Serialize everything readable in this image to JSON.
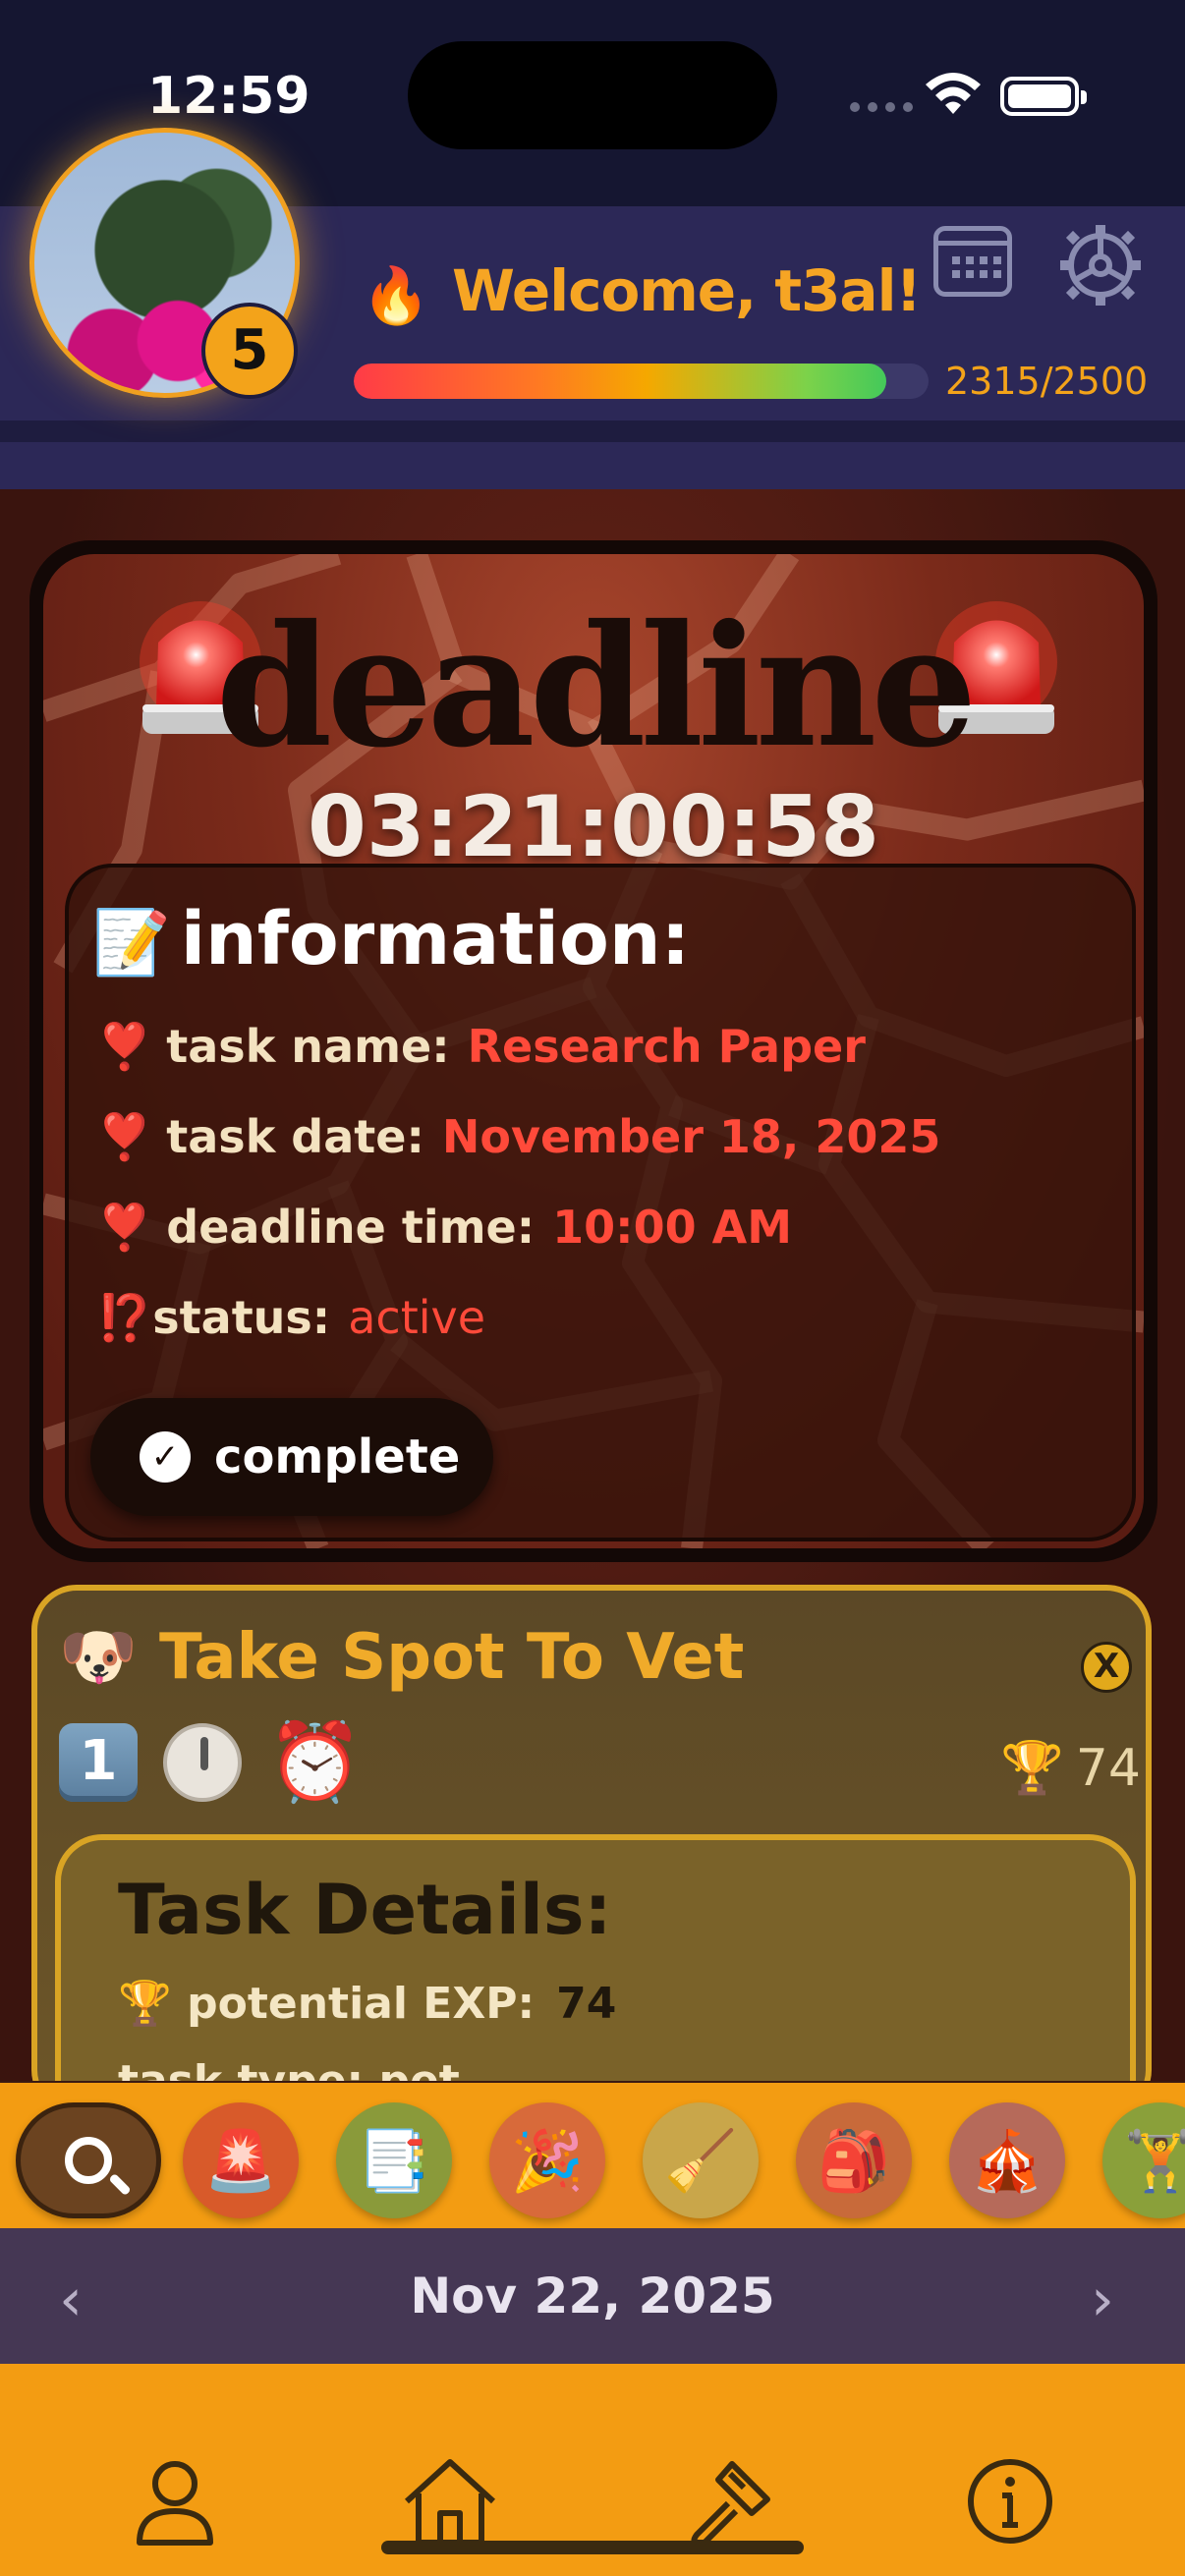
{
  "status_bar": {
    "time": "12:59"
  },
  "header": {
    "level": "5",
    "flame_icon": "🔥",
    "welcome": "Welcome, t3al!",
    "xp_text": "2315/2500",
    "xp_progress": 0.926
  },
  "deadline_card": {
    "title": "deadline",
    "countdown": "03:21:00:58",
    "info": {
      "heading_icon": "📝",
      "heading": "information:",
      "task_name_label": "task name:",
      "task_name": "Research Paper",
      "task_date_label": "task date:",
      "task_date": "November 18, 2025",
      "deadline_time_label": "deadline time:",
      "deadline_time": "10:00 AM",
      "status_label": "status:",
      "status": "active",
      "bullet": "❣️",
      "status_bullet": "⁉️"
    },
    "complete_label": "complete",
    "check_glyph": "✓"
  },
  "task_card": {
    "emoji": "🐶",
    "title": "Take Spot To Vet",
    "close_glyph": "X",
    "priority": "1",
    "alarm_icon": "⏰",
    "trophy_icon": "🏆",
    "score": "74",
    "details": {
      "title": "Task Details:",
      "exp_label": "potential EXP:",
      "exp_value": "74",
      "type_partial": "task type: pet"
    }
  },
  "categories": [
    {
      "name": "search",
      "icon": "search-icon"
    },
    {
      "name": "deadline",
      "icon": "🚨",
      "color": "#d85a2a"
    },
    {
      "name": "documents",
      "icon": "📑",
      "color": "#8a9a3a"
    },
    {
      "name": "party",
      "icon": "🎉",
      "color": "#d86a3a"
    },
    {
      "name": "chores",
      "icon": "🧹",
      "color": "#c9a64a"
    },
    {
      "name": "school",
      "icon": "🎒",
      "color": "#c86a3a"
    },
    {
      "name": "events",
      "icon": "🎪",
      "color": "#b66a5a"
    },
    {
      "name": "fitness",
      "icon": "🏋️",
      "color": "#8aa03a"
    }
  ],
  "date_nav": {
    "prev": "‹",
    "date": "Nov 22, 2025",
    "next": "›"
  },
  "colors": {
    "accent": "#f39c12",
    "header": "#2c2857",
    "deadline_red": "#ff4a3a"
  }
}
